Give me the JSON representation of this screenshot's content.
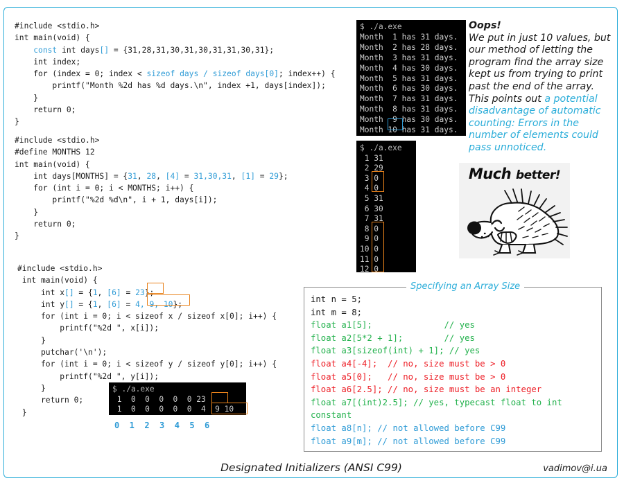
{
  "slide": {
    "border_color": "#2badd9",
    "footer_title": "Designated Initializers  (ANSI C99)",
    "footer_credit": "vadimov@i.ua"
  },
  "code_block_1": {
    "name": "automatic-counting-example",
    "lines": [
      "#include <stdio.h>",
      "int main(void) {",
      "    const int days[] = {31,28,31,30,31,30,31,31,30,31};",
      "    int index;",
      "    for (index = 0; index < sizeof days / sizeof days[0]; index++) {",
      "        printf(\"Month %2d has %d days.\\n\", index +1, days[index]);",
      "    }",
      "    return 0;",
      "}"
    ]
  },
  "code_block_2": {
    "name": "designated-initializer-months-example",
    "lines": [
      "#include <stdio.h>",
      "#define MONTHS 12",
      "int main(void) {",
      "    int days[MONTHS] = {31, 28, [4] = 31,30,31, [1] = 29};",
      "    for (int i = 0; i < MONTHS; i++) {",
      "        printf(\"%2d %d\\n\", i + 1, days[i]);",
      "    }",
      "    return 0;",
      "}"
    ]
  },
  "code_block_3": {
    "name": "designated-initializer-xy-example",
    "lines": [
      "#include <stdio.h>",
      " int main(void) {",
      "     int x[] = {1, [6] = 23};",
      "     int y[] = {1, [6] = 4, 9, 10};",
      "     for (int i = 0; i < sizeof x / sizeof x[0]; i++) {",
      "         printf(\"%2d \", x[i]);",
      "     }",
      "     putchar('\\n');",
      "     for (int i = 0; i < sizeof y / sizeof y[0]; i++) {",
      "         printf(\"%2d \", y[i]);",
      "     }",
      "     return 0;",
      " }"
    ]
  },
  "terminal_1": {
    "prompt": "$ ./a.exe",
    "lines": [
      "Month  1 has 31 days.",
      "Month  2 has 28 days.",
      "Month  3 has 31 days.",
      "Month  4 has 30 days.",
      "Month  5 has 31 days.",
      "Month  6 has 30 days.",
      "Month  7 has 31 days.",
      "Month  8 has 31 days.",
      "Month  9 has 30 days.",
      "Month 10 has 31 days."
    ],
    "highlight": "10",
    "highlight_color": "#2e9bd6"
  },
  "terminal_2": {
    "prompt": "$ ./a.exe",
    "lines": [
      " 1 31",
      " 2 29",
      " 3 0",
      " 4 0",
      " 5 31",
      " 6 30",
      " 7 31",
      " 8 0",
      " 9 0",
      "10 0",
      "11 0",
      "12 0"
    ],
    "highlight_color": "#e8811a"
  },
  "terminal_3": {
    "prompt": "$ ./a.exe",
    "lines": [
      " 1  0  0  0  0  0 23",
      " 1  0  0  0  0  0  4  9 10"
    ],
    "index_row": "0  1  2  3  4  5  6",
    "index_color": "#2e9bd6",
    "highlight_color": "#e8811a"
  },
  "note_oops": {
    "heading": "Oops!",
    "body_black": "We put in just 10 values, but our method of letting the program find the array size kept us from trying to print past the end of the array. This points out ",
    "body_cyan": "a potential disadvantage of automatic counting: Errors in the number of elements could pass unnoticed."
  },
  "picture": {
    "name": "hedgehog-much-better",
    "caption_bold": "Much",
    "caption_rest": "better!"
  },
  "array_size_box": {
    "legend": "Specifying an Array Size",
    "lines": [
      {
        "code": "int n = 5;",
        "comment": "",
        "code_color": "#1a1a1a",
        "comment_color": "#1a1a1a"
      },
      {
        "code": "int m = 8;",
        "comment": "",
        "code_color": "#1a1a1a",
        "comment_color": "#1a1a1a"
      },
      {
        "code": "float a1[5];",
        "comment": "// yes",
        "code_color": "#22b14c",
        "comment_color": "#22b14c",
        "pad": 22
      },
      {
        "code": "float a2[5*2 + 1];",
        "comment": "// yes",
        "code_color": "#22b14c",
        "comment_color": "#22b14c",
        "pad": 22
      },
      {
        "code": "float a3[sizeof(int) + 1];",
        "comment": "// yes",
        "code_color": "#22b14c",
        "comment_color": "#22b14c",
        "pad": 1
      },
      {
        "code": "float a4[-4];",
        "comment": "// no, size must be > 0",
        "code_color": "#ed1c24",
        "comment_color": "#ed1c24",
        "pad": 2
      },
      {
        "code": "float a5[0];",
        "comment": "// no, size must be > 0",
        "code_color": "#ed1c24",
        "comment_color": "#ed1c24",
        "pad": 3
      },
      {
        "code": "float a6[2.5];",
        "comment": "// no, size must be an integer",
        "code_color": "#ed1c24",
        "comment_color": "#ed1c24",
        "pad": 1
      },
      {
        "code": "float a7[(int)2.5];",
        "comment": "// yes, typecast float to int",
        "code_color": "#22b14c",
        "comment_color": "#22b14c",
        "pad": 1
      },
      {
        "code": "constant",
        "comment": "",
        "code_color": "#22b14c",
        "comment_color": "#22b14c"
      },
      {
        "code": "float a8[n];",
        "comment": "// not allowed before C99",
        "code_color": "#2e9bd6",
        "comment_color": "#2e9bd6",
        "pad": 1
      },
      {
        "code": "float a9[m];",
        "comment": "// not allowed before C99",
        "code_color": "#2e9bd6",
        "comment_color": "#2e9bd6",
        "pad": 1
      }
    ]
  }
}
